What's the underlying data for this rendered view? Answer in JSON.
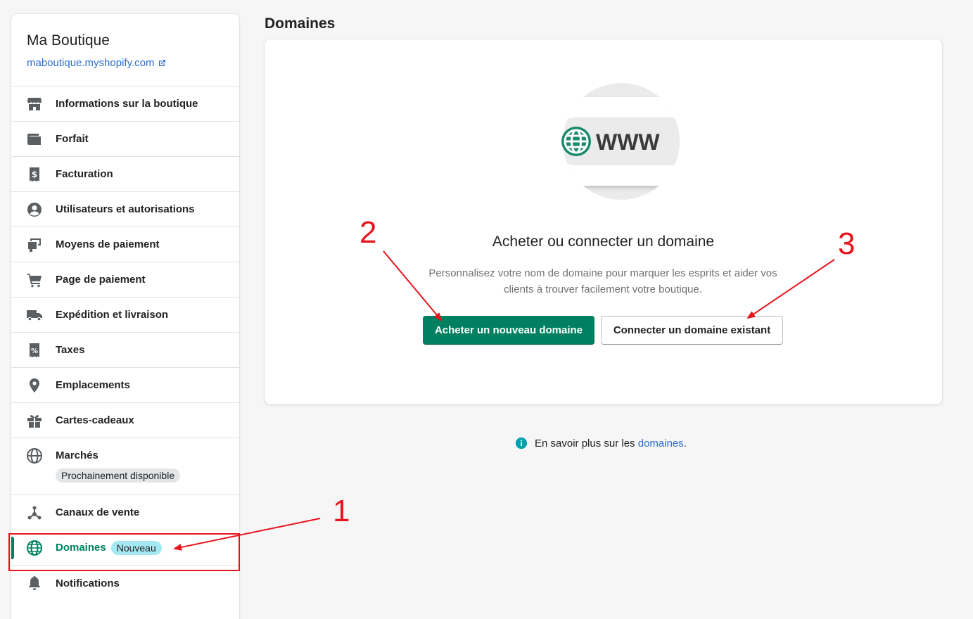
{
  "sidebar": {
    "store_name": "Ma Boutique",
    "store_url": "maboutique.myshopify.com",
    "items": [
      {
        "label": "Informations sur la boutique",
        "icon": "store-icon"
      },
      {
        "label": "Forfait",
        "icon": "wallet-icon"
      },
      {
        "label": "Facturation",
        "icon": "receipt-dollar-icon"
      },
      {
        "label": "Utilisateurs et autorisations",
        "icon": "user-circle-icon"
      },
      {
        "label": "Moyens de paiement",
        "icon": "payment-icon"
      },
      {
        "label": "Page de paiement",
        "icon": "cart-icon"
      },
      {
        "label": "Expédition et livraison",
        "icon": "truck-icon"
      },
      {
        "label": "Taxes",
        "icon": "tax-receipt-icon"
      },
      {
        "label": "Emplacements",
        "icon": "location-pin-icon"
      },
      {
        "label": "Cartes-cadeaux",
        "icon": "gift-icon"
      },
      {
        "label": "Marchés",
        "icon": "globe-icon",
        "badge": "Prochainement disponible"
      },
      {
        "label": "Canaux de vente",
        "icon": "channels-icon"
      },
      {
        "label": "Domaines",
        "icon": "domain-globe-icon",
        "badge": "Nouveau",
        "active": true
      },
      {
        "label": "Notifications",
        "icon": "bell-icon"
      }
    ]
  },
  "main": {
    "page_title": "Domaines",
    "card": {
      "illustration_text": "WWW",
      "heading": "Acheter ou connecter un domaine",
      "description": "Personnalisez votre nom de domaine pour marquer les esprits et aider vos clients à trouver facilement votre boutique.",
      "primary_button": "Acheter un nouveau domaine",
      "secondary_button": "Connecter un domaine existant"
    },
    "learn_more": {
      "prefix": "En savoir plus sur les ",
      "link": "domaines",
      "suffix": "."
    }
  },
  "annotations": {
    "labels": [
      "1",
      "2",
      "3"
    ],
    "color": "#e8141c"
  },
  "colors": {
    "primary": "#008060",
    "link": "#2c6ecb",
    "badge_new": "#a4e8f2",
    "badge_neutral": "#e4e5e7"
  }
}
